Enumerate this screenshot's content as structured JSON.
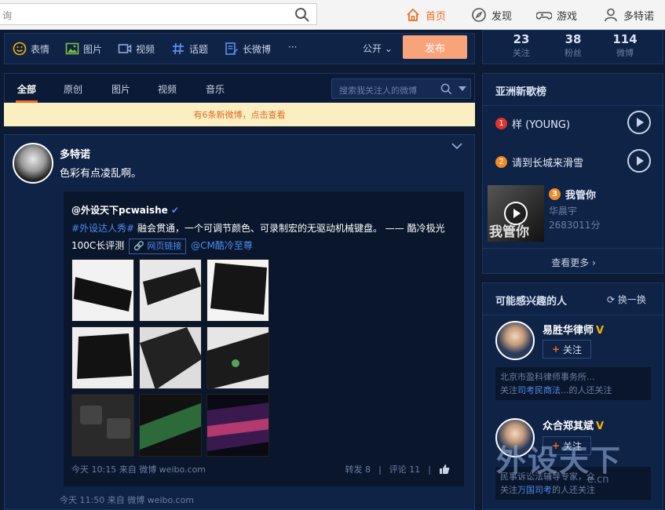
{
  "topbar": {
    "search_placeholder": "询",
    "nav": [
      {
        "label": "首页",
        "icon": "home-icon"
      },
      {
        "label": "发现",
        "icon": "compass-icon"
      },
      {
        "label": "游戏",
        "icon": "gamepad-icon"
      },
      {
        "label": "多特诺",
        "icon": "user-icon"
      }
    ]
  },
  "composer": {
    "tools": [
      {
        "label": "表情",
        "icon": "emoji-icon"
      },
      {
        "label": "图片",
        "icon": "image-icon"
      },
      {
        "label": "视频",
        "icon": "video-icon"
      },
      {
        "label": "话题",
        "icon": "hashtag-icon"
      },
      {
        "label": "长微博",
        "icon": "long-post-icon"
      }
    ],
    "more": "···",
    "visibility": "公开",
    "publish_label": "发布"
  },
  "feed_tabs": {
    "items": [
      "全部",
      "原创",
      "图片",
      "视频",
      "音乐"
    ],
    "active": "全部",
    "search_placeholder": "搜索我关注人的微博"
  },
  "notice": "有6条新微博，点击查看",
  "post": {
    "author": "多特诺",
    "text": "色彩有点凌乱啊。",
    "repost": {
      "author": "@外设天下pcwaishe",
      "topic": "#外设达人秀#",
      "text": " 融会贯通，一个可调节颜色、可录制宏的无驱动机械键盘。 —— 酷冷极光100C长评测",
      "link_label": "网页链接",
      "mention": "@CM酷冷至尊",
      "time": "今天 10:15 来自 微博 weibo.com",
      "repost_count": "转发 8",
      "comment_count": "评论 11"
    },
    "time": "今天 11:50 来自 微博 weibo.com"
  },
  "stats": [
    {
      "value": "23",
      "label": "关注"
    },
    {
      "value": "38",
      "label": "粉丝"
    },
    {
      "value": "114",
      "label": "微博"
    }
  ],
  "music": {
    "title": "亚洲新歌榜",
    "songs": [
      {
        "rank": "1",
        "title": "样 (YOUNG)"
      },
      {
        "rank": "2",
        "title": "请到长城来滑雪"
      },
      {
        "rank": "3",
        "title": "我管你",
        "artist": "华晨宇",
        "plays": "2683011分",
        "cover_text": "我管你"
      }
    ],
    "more": "查看更多 ›"
  },
  "recommend": {
    "title": "可能感兴趣的人",
    "refresh": "换一换",
    "follow_label": "关注",
    "people": [
      {
        "name": "易胜华律师",
        "desc": "北京市盈科律师事务所...",
        "reason_prefix": "关注",
        "reason_name": "司考民商法",
        "reason_suffix": "...的人还关注"
      },
      {
        "name": "众合郑其斌",
        "desc": "民事诉讼法辅导专家，众",
        "reason_prefix": "关注",
        "reason_name": "万国司考",
        "reason_suffix": "的人还关注"
      }
    ]
  },
  "watermark": {
    "big": "外设天下",
    "small": "e.cn"
  },
  "colors": {
    "accent": "#f26b1f",
    "link": "#4b8cf0",
    "background": "#0c1a33",
    "panel": "#0f2347"
  }
}
